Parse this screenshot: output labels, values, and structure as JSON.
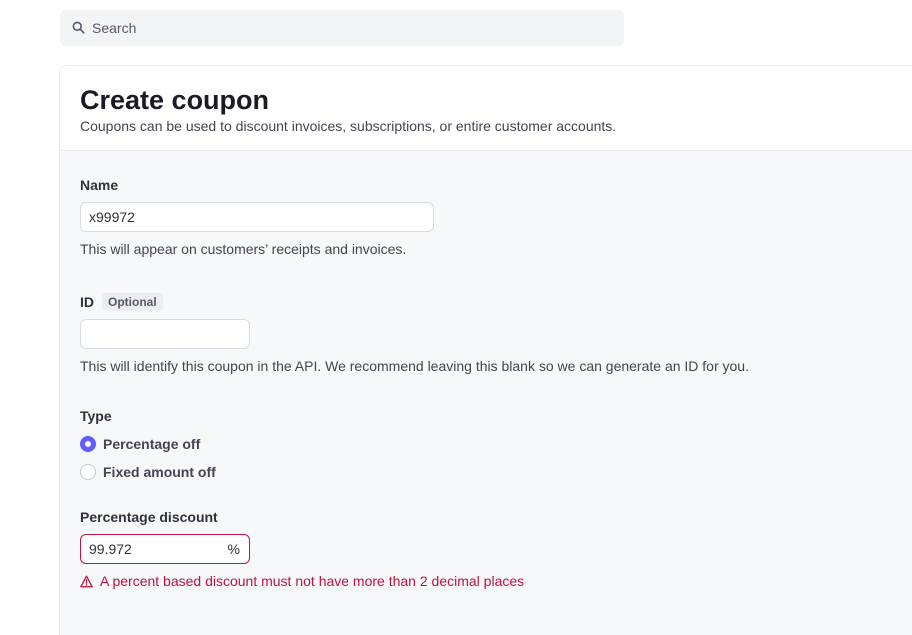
{
  "search": {
    "placeholder": "Search"
  },
  "page": {
    "title": "Create coupon",
    "subtitle": "Coupons can be used to discount invoices, subscriptions, or entire customer accounts."
  },
  "form": {
    "name": {
      "label": "Name",
      "value": "x99972",
      "help": "This will appear on customers’ receipts and invoices."
    },
    "id": {
      "label": "ID",
      "badge": "Optional",
      "value": "",
      "help": "This will identify this coupon in the API. We recommend leaving this blank so we can generate an ID for you."
    },
    "type": {
      "label": "Type",
      "options": [
        {
          "label": "Percentage off",
          "selected": true
        },
        {
          "label": "Fixed amount off",
          "selected": false
        }
      ]
    },
    "percentage": {
      "label": "Percentage discount",
      "value": "99.972",
      "suffix": "%",
      "error": "A percent based discount must not have more than 2 decimal places"
    }
  },
  "colors": {
    "accent": "#635bff",
    "error": "#c0123c"
  }
}
